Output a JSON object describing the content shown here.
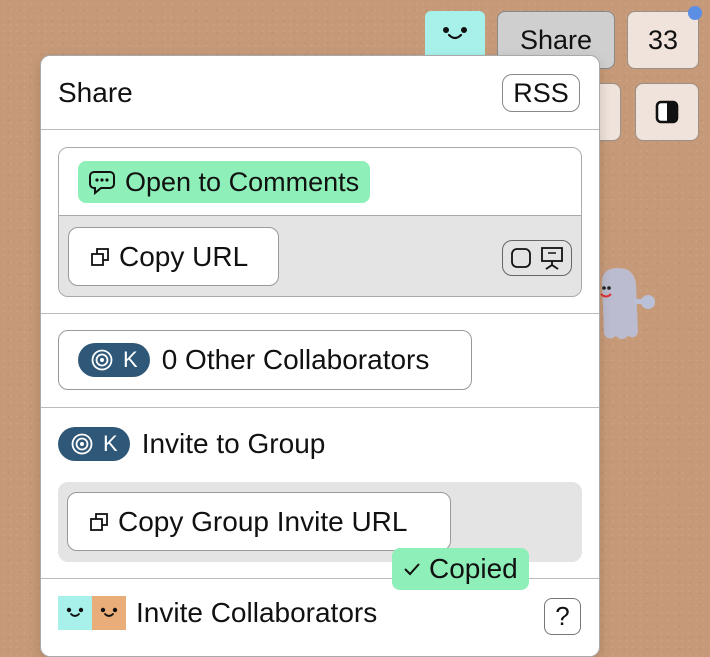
{
  "toolbar": {
    "share_label": "Share",
    "count": "33",
    "partial_label": "S",
    "notification_color": "#5b8fe6"
  },
  "panel": {
    "title": "Share",
    "rss_label": "RSS",
    "link": {
      "access_label": "Open to Comments",
      "access_icon": "comment-bubble-icon",
      "copy_url_label": "Copy URL",
      "view_modes": [
        "square-icon",
        "presentation-icon"
      ]
    },
    "collaborators": {
      "identity_letter": "K",
      "label": "0 Other Collaborators"
    },
    "group": {
      "identity_letter": "K",
      "label": "Invite to Group",
      "copy_label": "Copy Group Invite URL",
      "copied_label": "Copied"
    },
    "invite": {
      "label": "Invite Collaborators",
      "help_label": "?"
    }
  },
  "colors": {
    "background": "#c69a78",
    "accent_green": "#8ef0b8",
    "identity_blue": "#2f5878",
    "avatar_teal": "#a8f0ea",
    "avatar_orange": "#e8ad78"
  }
}
